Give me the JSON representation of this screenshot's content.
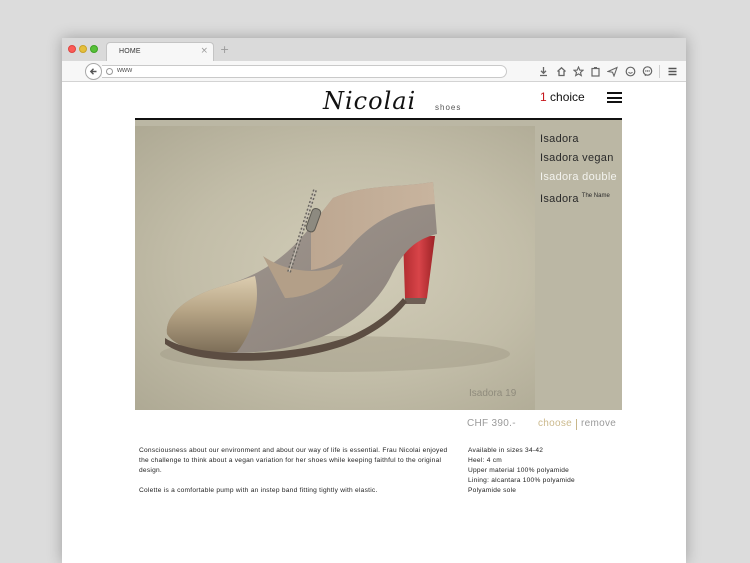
{
  "browser": {
    "tab_title": "HOME",
    "tab_close": "×",
    "new_tab": "+",
    "url": "www"
  },
  "header": {
    "logo_text": "Nicolai",
    "logo_sub": "shoes",
    "choice_count": "1",
    "choice_label": "choice"
  },
  "product": {
    "photo_caption": "Isadora 19",
    "variants": [
      {
        "label": "Isadora"
      },
      {
        "label": "Isadora vegan"
      },
      {
        "label": "Isadora double"
      },
      {
        "label": "Isadora",
        "sup": "The Name"
      }
    ],
    "active_variant": "Isadora double",
    "price": "CHF 390.-",
    "choose_label": "choose",
    "remove_label": "remove",
    "description": [
      "Consciousness about our environment and about our way of life is essential. Frau Nicolai enjoyed the challenge to think about a vegan variation for her shoes while keeping faithful to the original design.",
      "Colette is a comfortable pump with an instep band fitting tightly with elastic."
    ],
    "specs": [
      "Available in sizes 34-42",
      "Heel: 4 cm",
      "Upper material 100% polyamide",
      "Lining: alcantara 100% polyamide",
      "Polyamide sole"
    ]
  },
  "colors": {
    "accent_red": "#c6151b",
    "choose_gold": "#cbb98c",
    "photo_bg": "#bbb7a4"
  },
  "icons": [
    "back-arrow-icon",
    "globe-icon",
    "download-icon",
    "home-icon",
    "star-icon",
    "clipboard-icon",
    "send-icon",
    "smiley-icon",
    "chat-icon",
    "menu-icon",
    "hamburger-icon"
  ]
}
